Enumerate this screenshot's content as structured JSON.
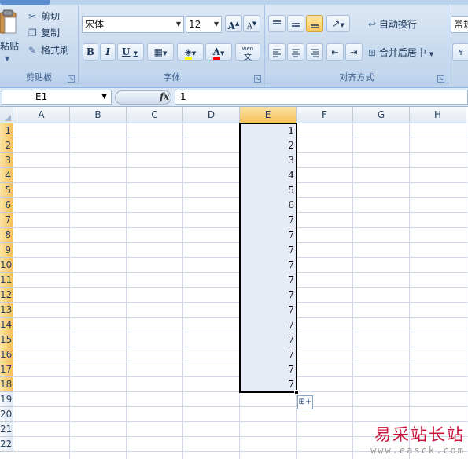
{
  "ribbon": {
    "clipboard": {
      "paste_label": "粘贴",
      "cut_label": "剪切",
      "copy_label": "复制",
      "format_painter_label": "格式刷",
      "group_label": "剪贴板"
    },
    "font": {
      "font_name": "宋体",
      "font_size": "12",
      "grow_label": "A",
      "shrink_label": "A",
      "bold_label": "B",
      "italic_label": "I",
      "underline_label": "U",
      "font_color_label": "A",
      "phonetic_label": "wén",
      "phonetic_char": "文",
      "group_label": "字体",
      "fill_color": "#ffff00",
      "font_color": "#ff0000"
    },
    "alignment": {
      "wrap_text_label": "自动换行",
      "merge_center_label": "合并后居中",
      "group_label": "对齐方式"
    },
    "number": {
      "format_label": "常规"
    }
  },
  "formula_bar": {
    "name_box": "E1",
    "fx_label": "fx",
    "formula": "1"
  },
  "sheet": {
    "columns": [
      "A",
      "B",
      "C",
      "D",
      "E",
      "F",
      "G",
      "H"
    ],
    "selected_column": "E",
    "row_numbers": [
      "1",
      "2",
      "3",
      "4",
      "5",
      "6",
      "7",
      "8",
      "9",
      "10",
      "11",
      "12",
      "13",
      "14",
      "15",
      "16",
      "17",
      "18",
      "19",
      "20",
      "21",
      "22"
    ],
    "column_e_values": [
      "1",
      "2",
      "3",
      "4",
      "5",
      "6",
      "7",
      "7",
      "7",
      "7",
      "7",
      "7",
      "7",
      "7",
      "7",
      "7",
      "7",
      "7"
    ],
    "selected_rows": 18
  },
  "autofill_options": {
    "icon": "autofill-options-icon"
  },
  "watermark": {
    "title": "易采站长站",
    "url": "www.easck.com"
  }
}
